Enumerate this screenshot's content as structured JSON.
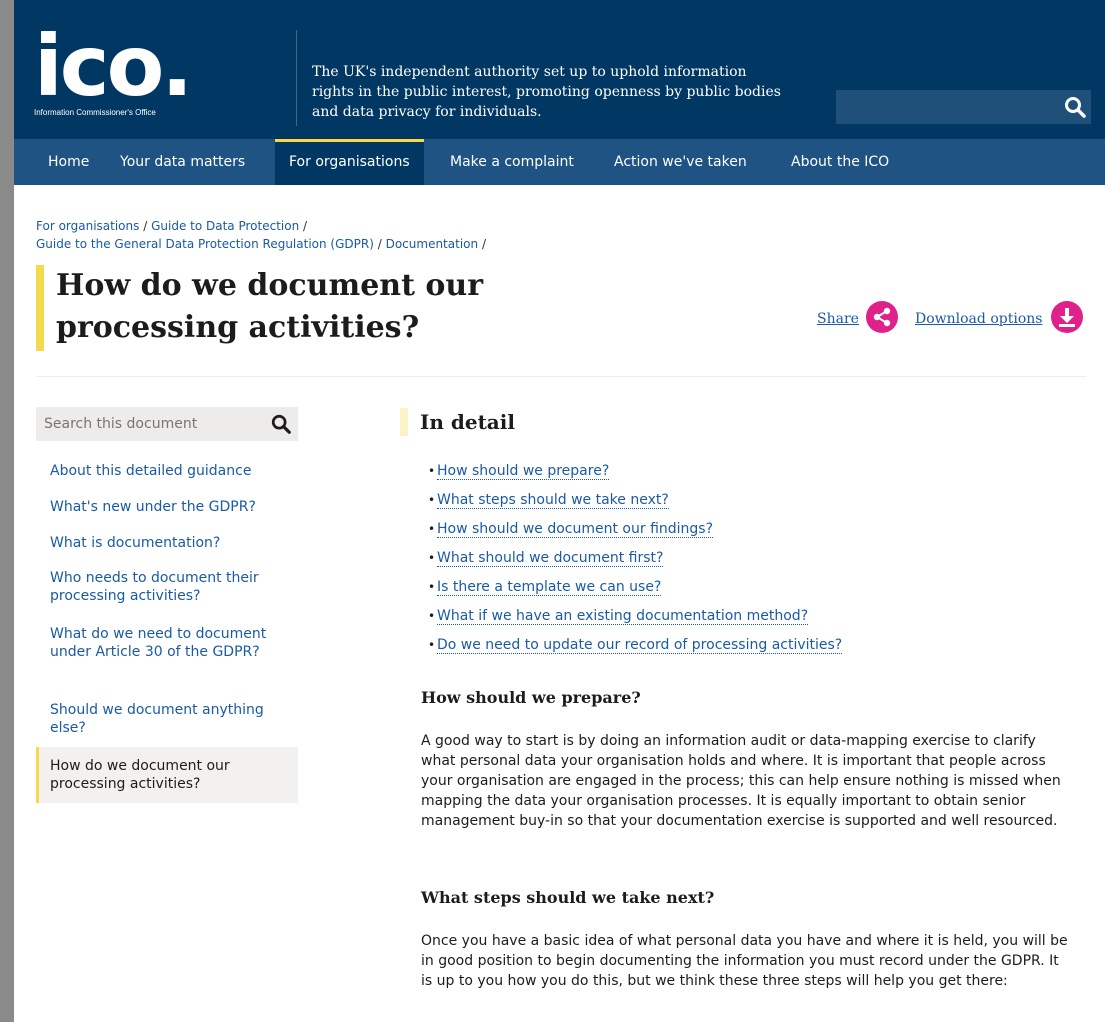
{
  "header": {
    "logo_text": "ico.",
    "logo_subtitle": "Information Commissioner's Office",
    "tagline": "The UK's independent authority set up to uphold information rights in the public interest, promoting openness by public bodies and data privacy for individuals.",
    "search_placeholder": ""
  },
  "nav": {
    "items": [
      "Home",
      "Your data matters",
      "For organisations",
      "Make a complaint",
      "Action we've taken",
      "About the ICO"
    ],
    "active": "For organisations"
  },
  "breadcrumb": {
    "line1": [
      "For organisations",
      "Guide to Data Protection"
    ],
    "line2": [
      "Guide to the General Data Protection Regulation (GDPR)",
      "Documentation"
    ],
    "separator": "/"
  },
  "page": {
    "title": "How do we document our processing activities?",
    "share_label": "Share",
    "download_label": "Download options"
  },
  "sidebar": {
    "search_placeholder": "Search this document",
    "items": [
      "About this detailed guidance",
      "What's new under the GDPR?",
      "What is documentation?",
      "Who needs to document their processing activities?",
      "What do we need to document under Article 30 of the GDPR?",
      "Should we document anything else?",
      "How do we document our processing activities?"
    ]
  },
  "main": {
    "heading": "In detail",
    "toc": [
      "How should we prepare?",
      "What steps should we take next?",
      "How should we document our findings?",
      "What should we document first?",
      "Is there a template we can use?",
      "What if we have an existing documentation method?",
      "Do we need to update our record of processing activities?"
    ],
    "sections": [
      {
        "heading": "How should we prepare?",
        "body": "A good way to start is by doing an information audit or data-mapping exercise to clarify what personal data your organisation holds and where. It is important that people across your organisation are engaged in the process; this can help ensure nothing is missed when mapping the data your organisation processes. It is equally important to obtain senior management buy-in so that your documentation exercise is supported and well resourced."
      },
      {
        "heading": "What steps should we take next?",
        "body": "Once you have a basic idea of what personal data you have and where it is held, you will be in good position to begin documenting the information you must record under the GDPR. It is up to you how you do this, but we think these three steps will help you get there:"
      }
    ]
  },
  "colors": {
    "header_bg": "#003863",
    "nav_bg": "#1e5383",
    "accent_yellow": "#f6d94d",
    "accent_pink": "#e0218a",
    "link": "#1a5aa6"
  }
}
